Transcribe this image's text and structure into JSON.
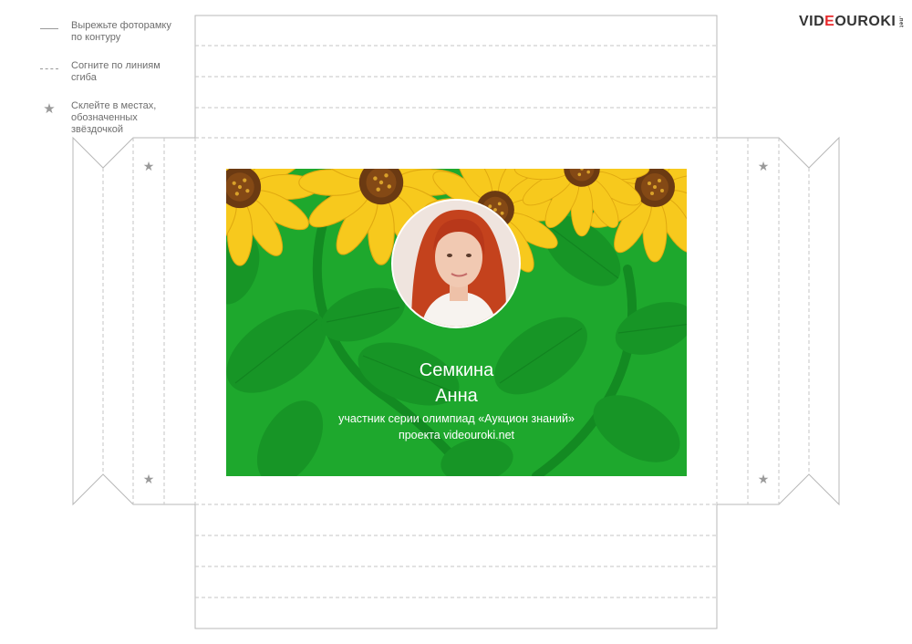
{
  "legend": {
    "cut_label": "Вырежьте фоторамку\nпо контуру",
    "fold_label": "Согните по линиям\nсгиба",
    "glue_label": "Склейте в местах,\nобозначенных\nзвёздочкой",
    "glue_icon": "star-icon"
  },
  "logo": {
    "text_before": "VID",
    "text_o": "E",
    "text_after": "OUROKI",
    "suffix": ".net"
  },
  "card": {
    "first_name": "Семкина",
    "last_name": "Анна",
    "caption_line1": "участник серии олимпиад «Аукцион знаний»",
    "caption_line2": "проекта videouroki.net"
  },
  "colors": {
    "background_green": "#1ea82d",
    "petal_yellow": "#f7c91d",
    "flower_center": "#6b3a12",
    "cut_line": "#b5b5b5",
    "fold_line": "#c4c4c4",
    "logo_accent": "#e8282b"
  }
}
